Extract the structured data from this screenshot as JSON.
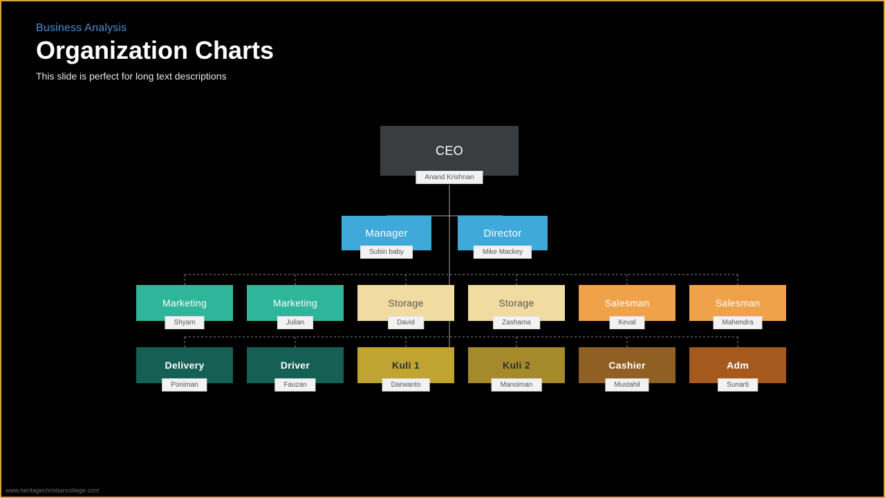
{
  "header": {
    "eyebrow": "Business Analysis",
    "title": "Organization Charts",
    "subtitle": "This slide is perfect for long text descriptions"
  },
  "chart_data": {
    "type": "tree",
    "root": {
      "role": "CEO",
      "name": "Anand Krishnan"
    },
    "level2": [
      {
        "role": "Manager",
        "name": "Subin baby"
      },
      {
        "role": "Director",
        "name": "Mike Mackey"
      }
    ],
    "level3": [
      {
        "role": "Marketing",
        "name": "Shyam",
        "color": "teal"
      },
      {
        "role": "Marketing",
        "name": "Julian",
        "color": "teal"
      },
      {
        "role": "Storage",
        "name": "David",
        "color": "cream"
      },
      {
        "role": "Storage",
        "name": "Zashama",
        "color": "cream"
      },
      {
        "role": "Salesman",
        "name": "Keval",
        "color": "orange"
      },
      {
        "role": "Salesman",
        "name": "Mahendra",
        "color": "orange"
      }
    ],
    "level4": [
      {
        "role": "Delivery",
        "name": "Poniman",
        "color": "darkteal"
      },
      {
        "role": "Driver",
        "name": "Fauzan",
        "color": "darkteal"
      },
      {
        "role": "Kuli 1",
        "name": "Darwanto",
        "color": "olive"
      },
      {
        "role": "Kuli 2",
        "name": "Manoiman",
        "color": "darkolive"
      },
      {
        "role": "Cashier",
        "name": "Mustahil",
        "color": "brown"
      },
      {
        "role": "Adm",
        "name": "Sunarti",
        "color": "rust"
      }
    ]
  },
  "watermark": "www.heritagechristiancollege.com"
}
